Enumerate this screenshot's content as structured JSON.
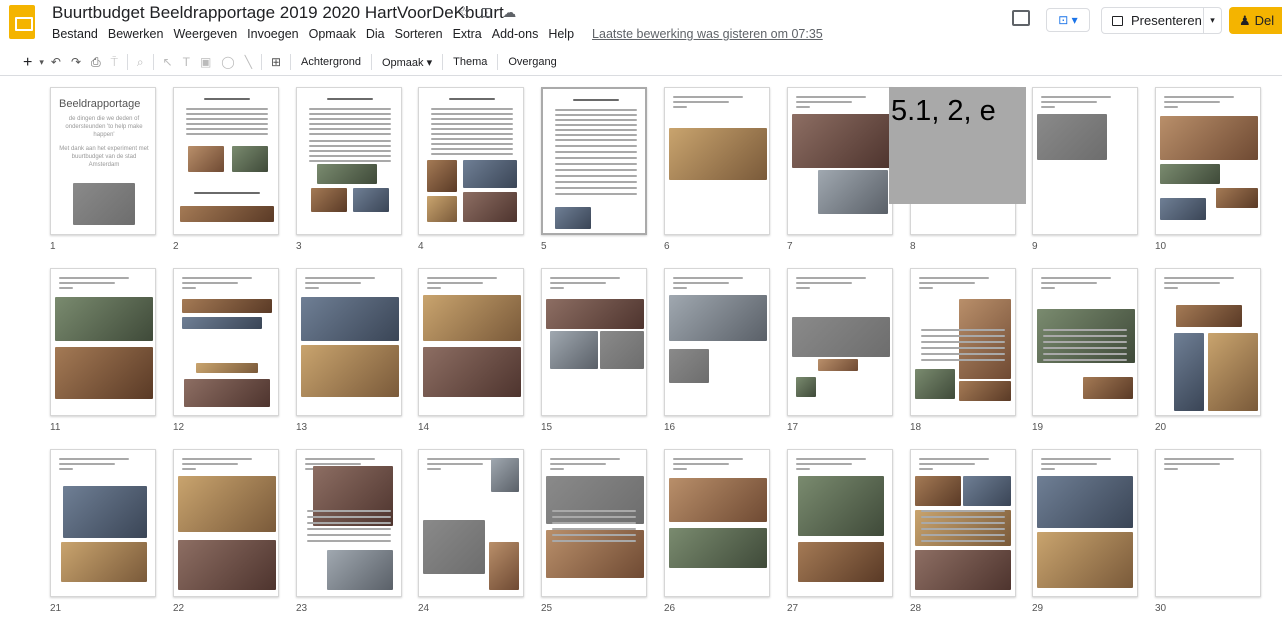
{
  "app": {
    "title": "Buurtbudget Beeldrapportage 2019 2020 HartVoorDeKbuurt",
    "star": "☆",
    "move": "⊡",
    "cloud": "☁",
    "menu": [
      "Bestand",
      "Bewerken",
      "Weergeven",
      "Invoegen",
      "Opmaak",
      "Dia",
      "Sorteren",
      "Extra",
      "Add-ons",
      "Help"
    ],
    "last_edit": "Laatste bewerking was gisteren om 07:35",
    "present_label": "Presenteren",
    "share_label": "Del"
  },
  "toolbar": {
    "add": "+",
    "add_caret": "▾",
    "undo": "↶",
    "redo": "↷",
    "print": "⎙",
    "paint": "⍑",
    "zoom": "⌕",
    "select": "↖",
    "textbox": "T",
    "image": "▣",
    "shape": "◯",
    "line": "╲",
    "comment": "⊞",
    "background": "Achtergrond",
    "layout": "Opmaak ▾",
    "theme": "Thema",
    "transition": "Overgang"
  },
  "overlay_label": "5.1, 2, e",
  "slide1": {
    "title": "Beeldrapportage",
    "sub": "de dingen die we deden of ondersteunden 'to help make happen'",
    "sub2": "Met dank aan het experiment met buurtbudget van de stad Amsterdam"
  },
  "slides": [
    "1",
    "2",
    "3",
    "4",
    "5",
    "6",
    "7",
    "8",
    "9",
    "10",
    "11",
    "12",
    "13",
    "14",
    "15",
    "16",
    "17",
    "18",
    "19",
    "20",
    "21",
    "22",
    "23",
    "24",
    "25",
    "26",
    "27",
    "28",
    "29",
    "30"
  ]
}
